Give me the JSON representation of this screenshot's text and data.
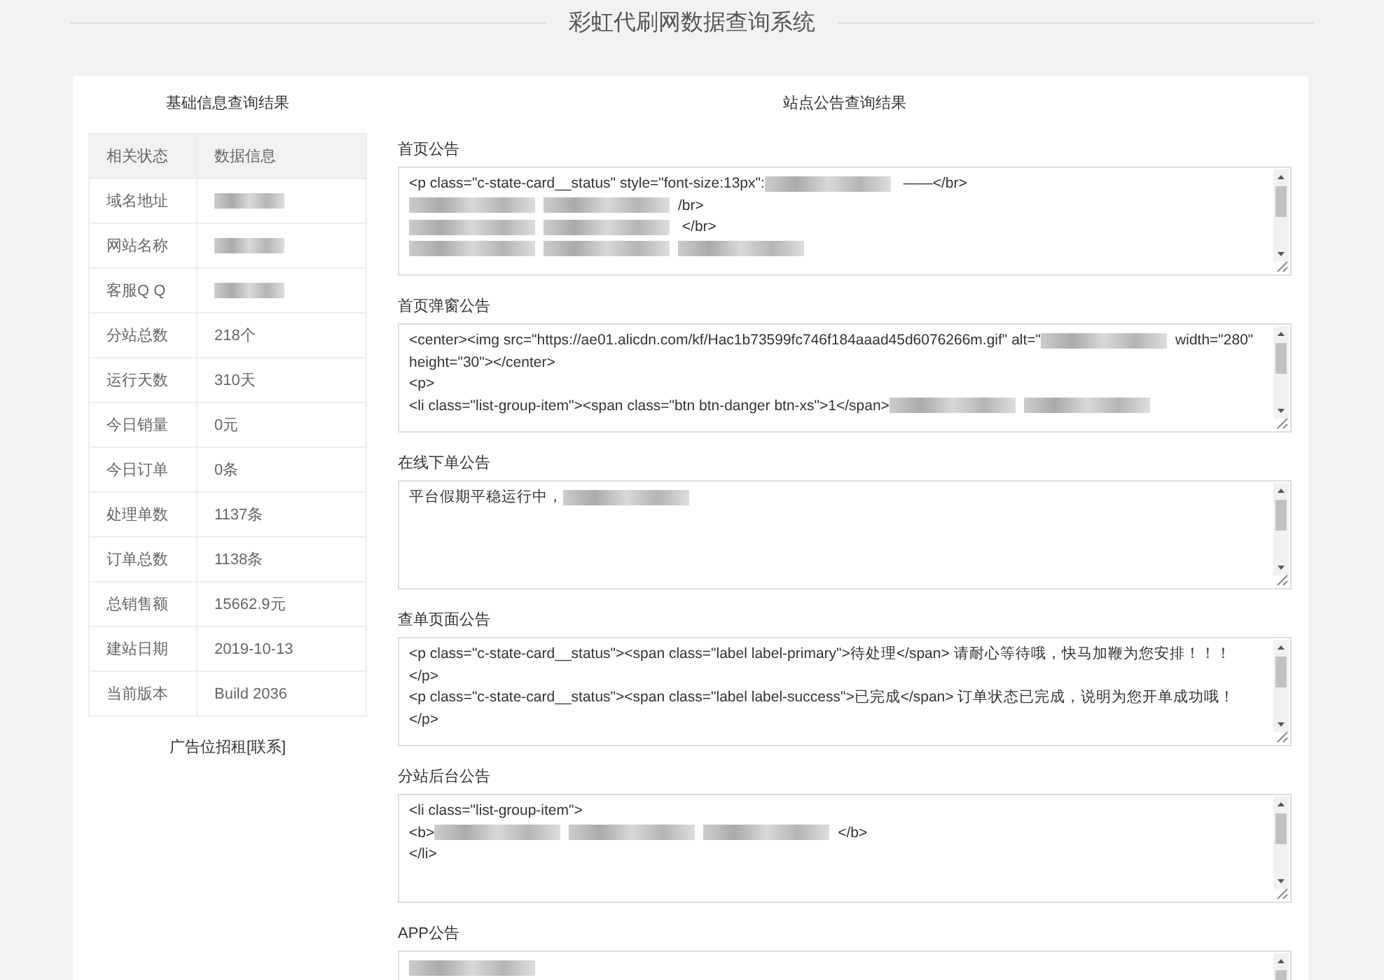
{
  "page_title": "彩虹代刷网数据查询系统",
  "basic_info": {
    "title": "基础信息查询结果",
    "columns": [
      "相关状态",
      "数据信息"
    ],
    "rows": [
      {
        "label": "域名地址",
        "redacted": true
      },
      {
        "label": "网站名称",
        "redacted": true
      },
      {
        "label": "客服Q Q",
        "redacted": true
      },
      {
        "label": "分站总数",
        "value": "218个",
        "redacted": false
      },
      {
        "label": "运行天数",
        "value": "310天",
        "redacted": false
      },
      {
        "label": "今日销量",
        "value": "0元",
        "redacted": false
      },
      {
        "label": "今日订单",
        "value": "0条",
        "redacted": false
      },
      {
        "label": "处理单数",
        "value": "1137条",
        "redacted": false
      },
      {
        "label": "订单总数",
        "value": "1138条",
        "redacted": false
      },
      {
        "label": "总销售额",
        "value": "15662.9元",
        "redacted": false
      },
      {
        "label": "建站日期",
        "value": "2019-10-13",
        "redacted": false
      },
      {
        "label": "当前版本",
        "value": "Build 2036",
        "redacted": false
      }
    ],
    "footer": "广告位招租[联系]"
  },
  "notices": {
    "title": "站点公告查询结果",
    "fields": [
      {
        "label": "首页公告",
        "lines": [
          [
            {
              "kind": "text",
              "text": " <p class=\"c-state-card__status\" style=\"font-size:13px\":"
            },
            {
              "kind": "redacted"
            },
            {
              "kind": "text",
              "text": " ——</br>"
            }
          ],
          [
            {
              "kind": "redacted"
            },
            {
              "kind": "redacted"
            },
            {
              "kind": "text",
              "text": "/br>"
            }
          ],
          [
            {
              "kind": "redacted"
            },
            {
              "kind": "redacted"
            },
            {
              "kind": "text",
              "text": " </br>"
            }
          ],
          [
            {
              "kind": "redacted"
            },
            {
              "kind": "redacted"
            },
            {
              "kind": "redacted"
            }
          ]
        ]
      },
      {
        "label": "首页弹窗公告",
        "lines": [
          [
            {
              "kind": "text",
              "text": "<center><img src=\"https://ae01.alicdn.com/kf/Hac1b73599fc746f184aaad45d6076266m.gif\" alt=\""
            },
            {
              "kind": "redacted"
            },
            {
              "kind": "text",
              "text": "width=\"280\""
            }
          ],
          [
            {
              "kind": "text",
              "text": "height=\"30\"></center>"
            }
          ],
          [
            {
              "kind": "text",
              "text": "<p>"
            }
          ],
          [
            {
              "kind": "text",
              "text": "<li class=\"list-group-item\"><span class=\"btn btn-danger btn-xs\">1</span>"
            },
            {
              "kind": "redacted"
            },
            {
              "kind": "redacted"
            }
          ]
        ]
      },
      {
        "label": "在线下单公告",
        "lines": [
          [
            {
              "kind": "text",
              "text": "平台假期平稳运行中，"
            },
            {
              "kind": "redacted"
            }
          ]
        ]
      },
      {
        "label": "查单页面公告",
        "lines": [
          [
            {
              "kind": "text",
              "text": "<p class=\"c-state-card__status\"><span class=\"label label-primary\">待处理</span> 请耐心等待哦，快马加鞭为您安排！！！"
            }
          ],
          [
            {
              "kind": "text",
              "text": "</p>"
            }
          ],
          [
            {
              "kind": "text",
              "text": "<p class=\"c-state-card__status\"><span class=\"label label-success\">已完成</span> 订单状态已完成，说明为您开单成功哦！"
            }
          ],
          [
            {
              "kind": "text",
              "text": "</p>"
            }
          ]
        ]
      },
      {
        "label": "分站后台公告",
        "lines": [
          [
            {
              "kind": "text",
              "text": "<li class=\"list-group-item\">"
            }
          ],
          [
            {
              "kind": "text",
              "text": "   <b>"
            },
            {
              "kind": "redacted"
            },
            {
              "kind": "redacted"
            },
            {
              "kind": "redacted"
            },
            {
              "kind": "text",
              "text": "</b>"
            }
          ],
          [
            {
              "kind": "text",
              "text": "</li>"
            }
          ]
        ]
      },
      {
        "label": "APP公告",
        "lines": [
          [
            {
              "kind": "redacted"
            }
          ]
        ]
      }
    ]
  }
}
